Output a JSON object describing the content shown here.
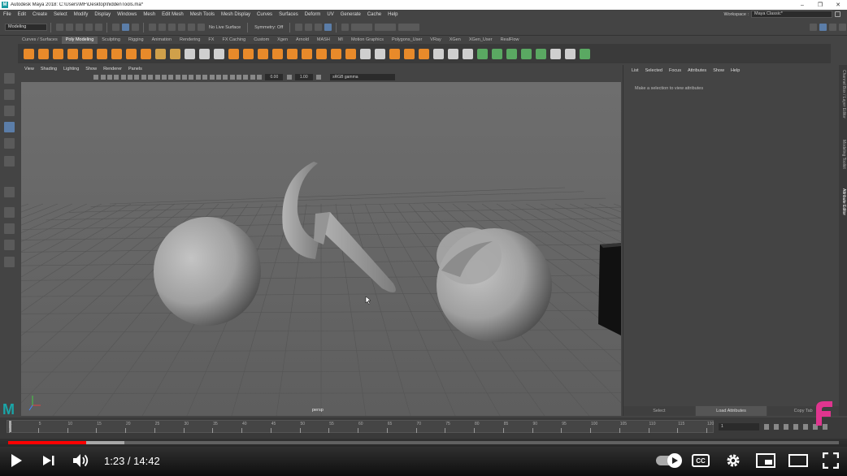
{
  "window": {
    "title": "Autodesk Maya 2018: C:\\Users\\MF\\Desktop\\hiddenTools.ma*",
    "logo_letter": "M",
    "min": "–",
    "max": "❐",
    "close": "✕"
  },
  "menubar": {
    "items": [
      "File",
      "Edit",
      "Create",
      "Select",
      "Modify",
      "Display",
      "Windows",
      "Mesh",
      "Edit Mesh",
      "Mesh Tools",
      "Mesh Display",
      "Curves",
      "Surfaces",
      "Deform",
      "UV",
      "Generate",
      "Cache",
      "Help"
    ],
    "workspace_label": "Workspace :",
    "workspace_value": "Maya Classic*"
  },
  "statusline": {
    "mode": "Modeling",
    "live_surface": "No Live Surface",
    "symmetry": "Symmetry: Off"
  },
  "shelf_tabs": {
    "items": [
      "Curves / Surfaces",
      "Poly Modeling",
      "Sculpting",
      "Rigging",
      "Animation",
      "Rendering",
      "FX",
      "FX Caching",
      "Custom",
      "Xgen",
      "Arnold",
      "MASH",
      "MI",
      "Motion Graphics",
      "Polygons_User",
      "VRay",
      "XGen",
      "XGen_User",
      "RealFlow"
    ],
    "active_index": 1
  },
  "viewport": {
    "menu": [
      "View",
      "Shading",
      "Lighting",
      "Show",
      "Renderer",
      "Panels"
    ],
    "near_value": "0.00",
    "far_value": "1.00",
    "color_space": "sRGB gamma",
    "camera": "persp"
  },
  "attribute_editor": {
    "menu": [
      "List",
      "Selected",
      "Focus",
      "Attributes",
      "Show",
      "Help"
    ],
    "hint": "Make a selection to view attributes",
    "buttons": [
      "Select",
      "Load Attributes",
      "Copy Tab"
    ],
    "side_tabs": [
      "Channel Box / Layer Editor",
      "Modeling Toolkit",
      "Attribute Editor"
    ]
  },
  "timeline": {
    "current_frame": "1",
    "ticks": [
      "1",
      "5",
      "10",
      "15",
      "20",
      "25",
      "30",
      "35",
      "40",
      "45",
      "50",
      "55",
      "60",
      "65",
      "70",
      "75",
      "80",
      "85",
      "90",
      "95",
      "100",
      "105",
      "110",
      "115",
      "120"
    ]
  },
  "player": {
    "current_time": "1:23",
    "duration": "14:42",
    "time_separator": " / ",
    "progress": 0.094,
    "buffered": 0.14,
    "cc_label": "CC",
    "progress_color": "#ff0000"
  },
  "brand": {
    "letter": "F",
    "color": "#e0358f"
  }
}
